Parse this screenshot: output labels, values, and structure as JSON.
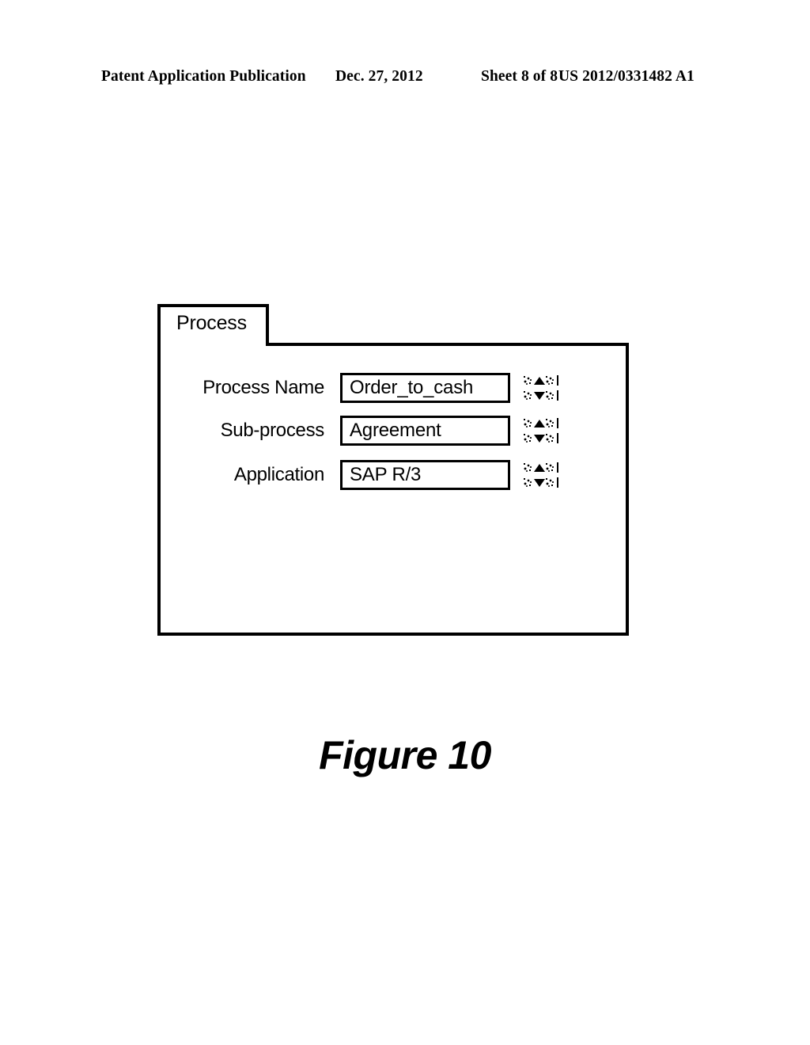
{
  "header": {
    "publication": "Patent Application Publication",
    "date": "Dec. 27, 2012",
    "sheet": "Sheet 8 of 8",
    "patent_number": "US 2012/0331482 A1"
  },
  "panel": {
    "tab_label": "Process",
    "rows": [
      {
        "label": "Process Name",
        "value": "Order_to_cash",
        "spinner_up": "increment-icon",
        "spinner_down": "decrement-icon"
      },
      {
        "label": "Sub-process",
        "value": "Agreement",
        "spinner_up": "increment-icon",
        "spinner_down": "decrement-icon"
      },
      {
        "label": "Application",
        "value": "SAP R/3",
        "spinner_up": "increment-icon",
        "spinner_down": "decrement-icon"
      }
    ]
  },
  "figure": {
    "caption": "Figure 10"
  }
}
